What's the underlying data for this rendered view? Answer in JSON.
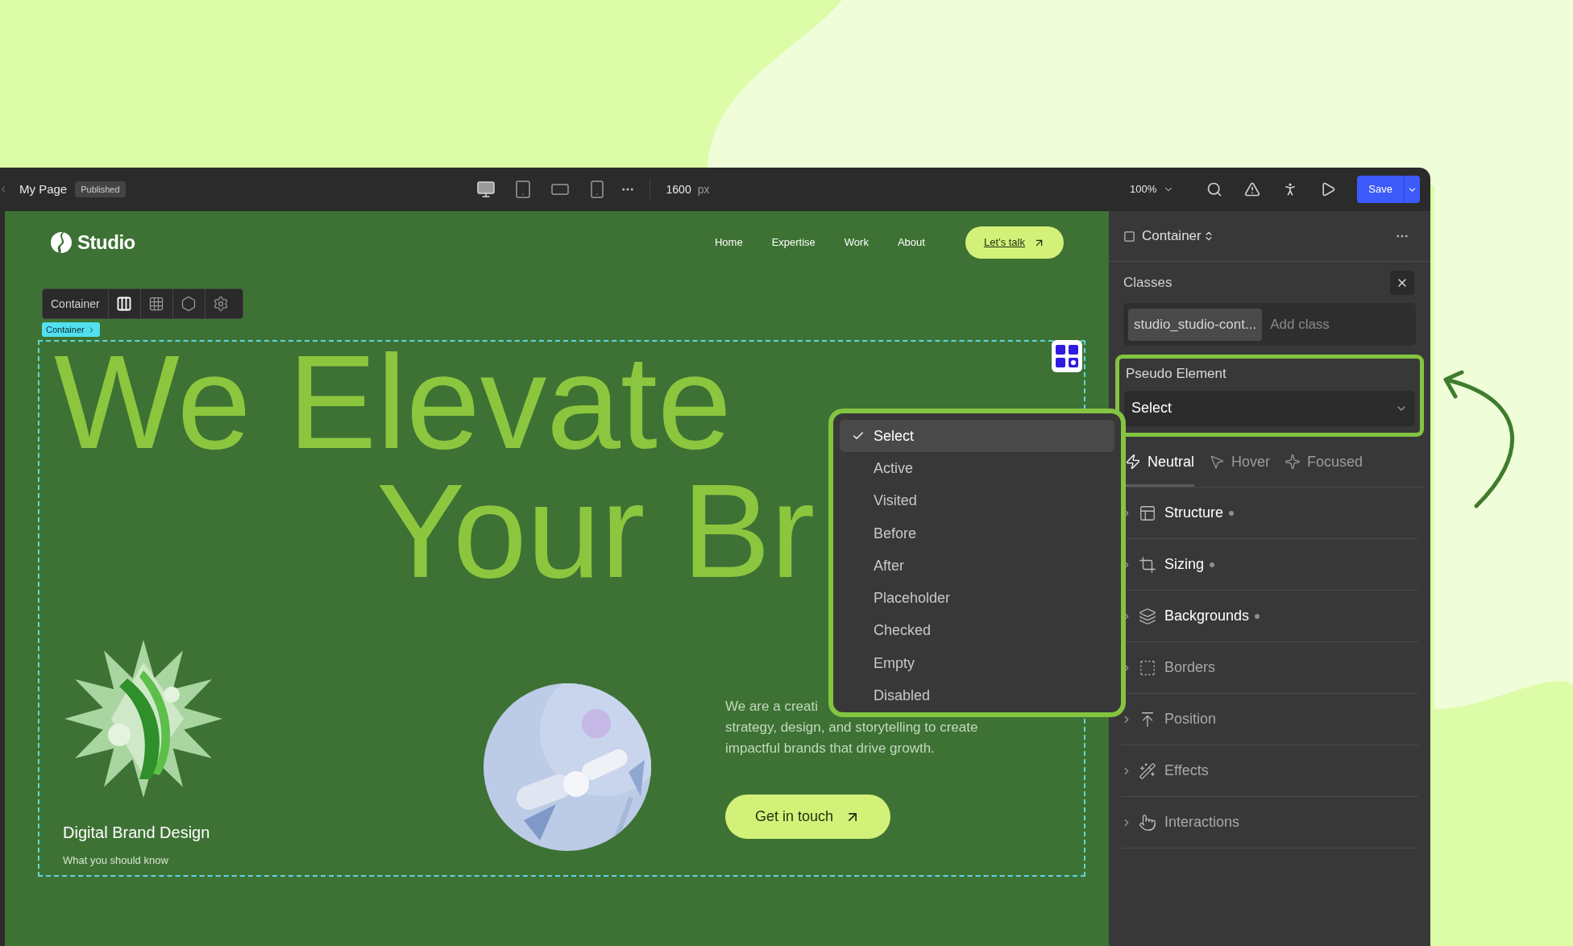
{
  "topbar": {
    "page_title": "My Page",
    "status_badge": "Published",
    "viewports": [
      {
        "kind": "desktop",
        "selected": true
      },
      {
        "kind": "tablet",
        "selected": false
      },
      {
        "kind": "landscape",
        "selected": false
      },
      {
        "kind": "mobile",
        "selected": false
      }
    ],
    "width_value": "1600",
    "width_unit": "px",
    "zoom": "100%",
    "save_label": "Save"
  },
  "canvas": {
    "brand": "Studio",
    "nav_links": [
      "Home",
      "Expertise",
      "Work",
      "About"
    ],
    "cta": "Let’s talk",
    "element_toolbar": {
      "label": "Container",
      "tools": [
        {
          "kind": "columns",
          "selected": true
        },
        {
          "kind": "grid",
          "selected": false
        },
        {
          "kind": "component",
          "selected": false
        },
        {
          "kind": "settings",
          "selected": false
        }
      ]
    },
    "breadcrumb": "Container",
    "headline_lines": [
      "We Elevate",
      "Your Br"
    ],
    "feature": {
      "title": "Digital Brand Design",
      "subtitle": "What you should know"
    },
    "intro_lines": [
      "We are a creati",
      "strategy, design, and storytelling to create",
      "impactful brands that drive growth."
    ],
    "button": "Get in touch"
  },
  "dropdown": {
    "options": [
      {
        "label": "Select",
        "selected": true
      },
      {
        "label": "Active",
        "selected": false
      },
      {
        "label": "Visited",
        "selected": false
      },
      {
        "label": "Before",
        "selected": false
      },
      {
        "label": "After",
        "selected": false
      },
      {
        "label": "Placeholder",
        "selected": false
      },
      {
        "label": "Checked",
        "selected": false
      },
      {
        "label": "Empty",
        "selected": false
      },
      {
        "label": "Disabled",
        "selected": false
      }
    ]
  },
  "panel": {
    "element": "Container",
    "classes_label": "Classes",
    "class_chip": "studio_studio-cont...",
    "class_placeholder": "Add class",
    "pseudo_label": "Pseudo Element",
    "pseudo_value": "Select",
    "states": [
      {
        "kind": "neutral",
        "label": "Neutral",
        "selected": true
      },
      {
        "kind": "hover",
        "label": "Hover",
        "selected": false
      },
      {
        "kind": "focused",
        "label": "Focused",
        "selected": false
      }
    ],
    "sections": [
      {
        "kind": "structure",
        "label": "Structure",
        "modified": true
      },
      {
        "kind": "sizing",
        "label": "Sizing",
        "modified": true
      },
      {
        "kind": "backgrounds",
        "label": "Backgrounds",
        "modified": true
      },
      {
        "kind": "borders",
        "label": "Borders",
        "modified": false
      },
      {
        "kind": "position",
        "label": "Position",
        "modified": false
      },
      {
        "kind": "effects",
        "label": "Effects",
        "modified": false
      },
      {
        "kind": "interactions",
        "label": "Interactions",
        "modified": false
      }
    ]
  }
}
